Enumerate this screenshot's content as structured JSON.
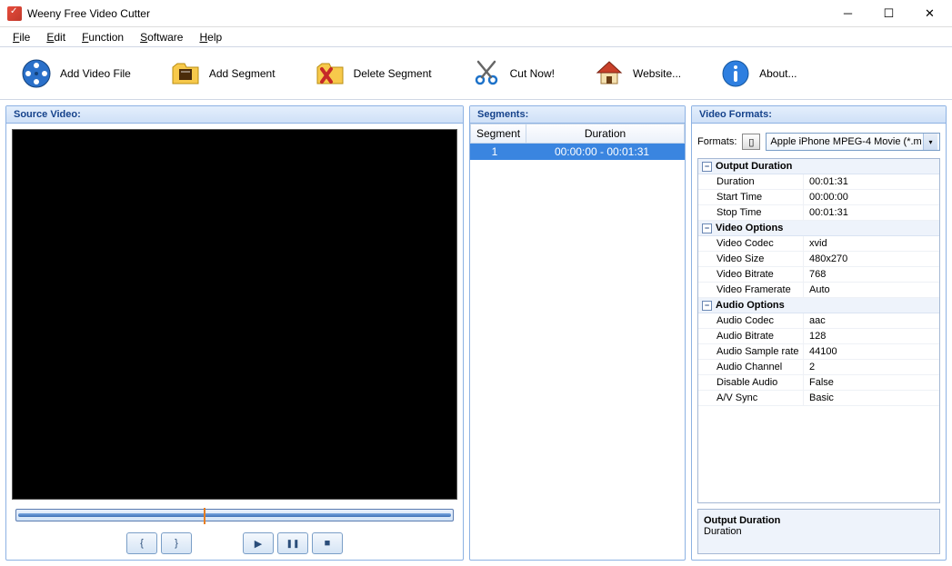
{
  "window": {
    "title": "Weeny Free Video Cutter"
  },
  "menu": {
    "file": "File",
    "edit": "Edit",
    "function": "Function",
    "software": "Software",
    "help": "Help"
  },
  "toolbar": {
    "add_video": "Add Video File",
    "add_segment": "Add Segment",
    "delete_segment": "Delete Segment",
    "cut_now": "Cut Now!",
    "website": "Website...",
    "about": "About..."
  },
  "panels": {
    "source": "Source Video:",
    "segments": "Segments:",
    "formats": "Video Formats:"
  },
  "segments_table": {
    "col_segment": "Segment",
    "col_duration": "Duration",
    "rows": [
      {
        "n": "1",
        "duration": "00:00:00 - 00:01:31"
      }
    ]
  },
  "formats": {
    "label": "Formats:",
    "selected": "Apple iPhone MPEG-4 Movie (*.m"
  },
  "propgrid": {
    "sections": [
      {
        "title": "Output Duration",
        "rows": [
          {
            "k": "Duration",
            "v": "00:01:31"
          },
          {
            "k": "Start Time",
            "v": "00:00:00"
          },
          {
            "k": "Stop Time",
            "v": "00:01:31"
          }
        ]
      },
      {
        "title": "Video Options",
        "rows": [
          {
            "k": "Video Codec",
            "v": "xvid"
          },
          {
            "k": "Video Size",
            "v": "480x270"
          },
          {
            "k": "Video Bitrate",
            "v": "768"
          },
          {
            "k": "Video Framerate",
            "v": "Auto"
          }
        ]
      },
      {
        "title": "Audio Options",
        "rows": [
          {
            "k": "Audio Codec",
            "v": "aac"
          },
          {
            "k": "Audio Bitrate",
            "v": "128"
          },
          {
            "k": "Audio Sample rate",
            "v": "44100"
          },
          {
            "k": "Audio Channel",
            "v": "2"
          },
          {
            "k": "Disable Audio",
            "v": "False"
          },
          {
            "k": "A/V Sync",
            "v": "Basic"
          }
        ]
      }
    ]
  },
  "description": {
    "title": "Output Duration",
    "body": "Duration"
  },
  "controls": {
    "mark_in": "{",
    "mark_out": "}",
    "play": "▶",
    "pause": "❚❚",
    "stop": "■"
  }
}
